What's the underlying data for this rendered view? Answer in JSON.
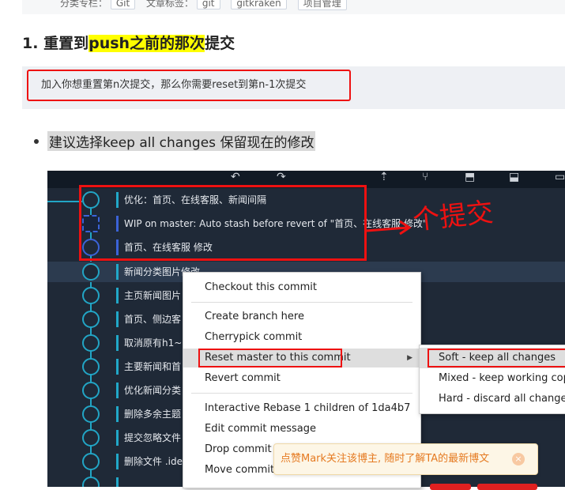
{
  "top_tags": {
    "prefix": "分类专栏：",
    "tags": [
      "Git",
      "文章标签：",
      "git",
      "gitkraken",
      "项目管理"
    ]
  },
  "heading": {
    "num": "1.",
    "pre": "重置到",
    "highlight": "push之前的那次",
    "post": "提交"
  },
  "quote": "加入你想重置第n次提交，那么你需要reset到第n-1次提交",
  "bullet": "建议选择keep all changes 保留现在的修改",
  "annotation": "个提交",
  "commits": [
    "优化：首页、在线客服、新闻间隔",
    "WIP on master: Auto stash before revert of \"首页、在线客服 修改\"",
    "首页、在线客服 修改",
    "新闻分类图片修改",
    "主页新闻图片",
    "首页、侧边客",
    "取消原有h1~",
    "主要新闻和首",
    "优化新闻分类",
    "删除多余主题",
    "提交忽略文件",
    "删除文件 .ide",
    ""
  ],
  "context_menu": {
    "checkout": "Checkout this commit",
    "create_branch": "Create branch here",
    "cherrypick": "Cherrypick commit",
    "reset": "Reset master to this commit",
    "revert": "Revert commit",
    "rebase": "Interactive Rebase 1 children of 1da4b7",
    "edit_msg": "Edit commit message",
    "drop": "Drop commit",
    "move": "Move commit"
  },
  "submenu": {
    "soft": "Soft - keep all changes",
    "mixed": "Mixed - keep working copy",
    "hard": "Hard - discard all changes"
  },
  "toast": {
    "text": "点赞Mark关注该博主, 随时了解TA的最新博文",
    "close": "×"
  },
  "colors": {
    "highlight": "#ffff00",
    "red": "#ee1111",
    "graph": "#22a5c5",
    "toast_text": "#e57a21"
  }
}
